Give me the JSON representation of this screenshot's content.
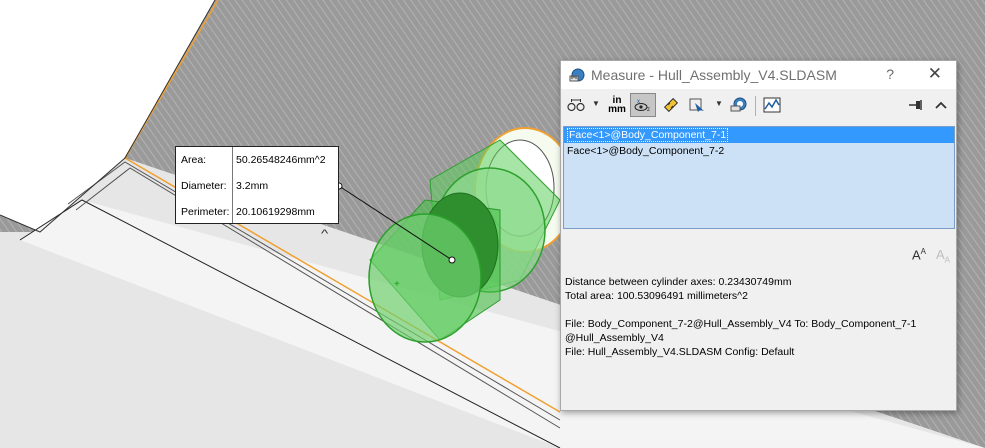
{
  "callout": {
    "rows": [
      {
        "label": "Area:",
        "value": "50.26548246mm^2"
      },
      {
        "label": "Diameter:",
        "value": "3.2mm"
      },
      {
        "label": "Perimeter:",
        "value": "20.10619298mm"
      }
    ],
    "collapse_caret": "^"
  },
  "dialog": {
    "title": "Measure - Hull_Assembly_V4.SLDASM",
    "help_label": "?",
    "close_label": "✕",
    "units_top": "in",
    "units_bottom": "mm",
    "selections": [
      {
        "text": "Face<1>@Body_Component_7-1",
        "selected": true
      },
      {
        "text": "Face<1>@Body_Component_7-2",
        "selected": false
      }
    ],
    "results": [
      "Distance between cylinder axes:  0.23430749mm",
      "Total area: 100.53096491 millimeters^2",
      "",
      "File: Body_Component_7-2@Hull_Assembly_V4 To: Body_Component_7-1",
      "@Hull_Assembly_V4",
      "File: Hull_Assembly_V4.SLDASM Config: Default"
    ]
  },
  "colors": {
    "edge_highlight": "#f0a030",
    "cylinder_green": "#38c038",
    "list_selected": "#3399ff",
    "list_background": "#cce1f5"
  },
  "icons": [
    "measure-icon",
    "arc-condition-icon",
    "units-icon",
    "show-xyz-icon",
    "point-to-point-icon",
    "projection-icon",
    "measurement-history-icon",
    "sensor-icon",
    "pin-icon",
    "collapse-icon",
    "font-increase-icon",
    "font-decrease-icon"
  ]
}
